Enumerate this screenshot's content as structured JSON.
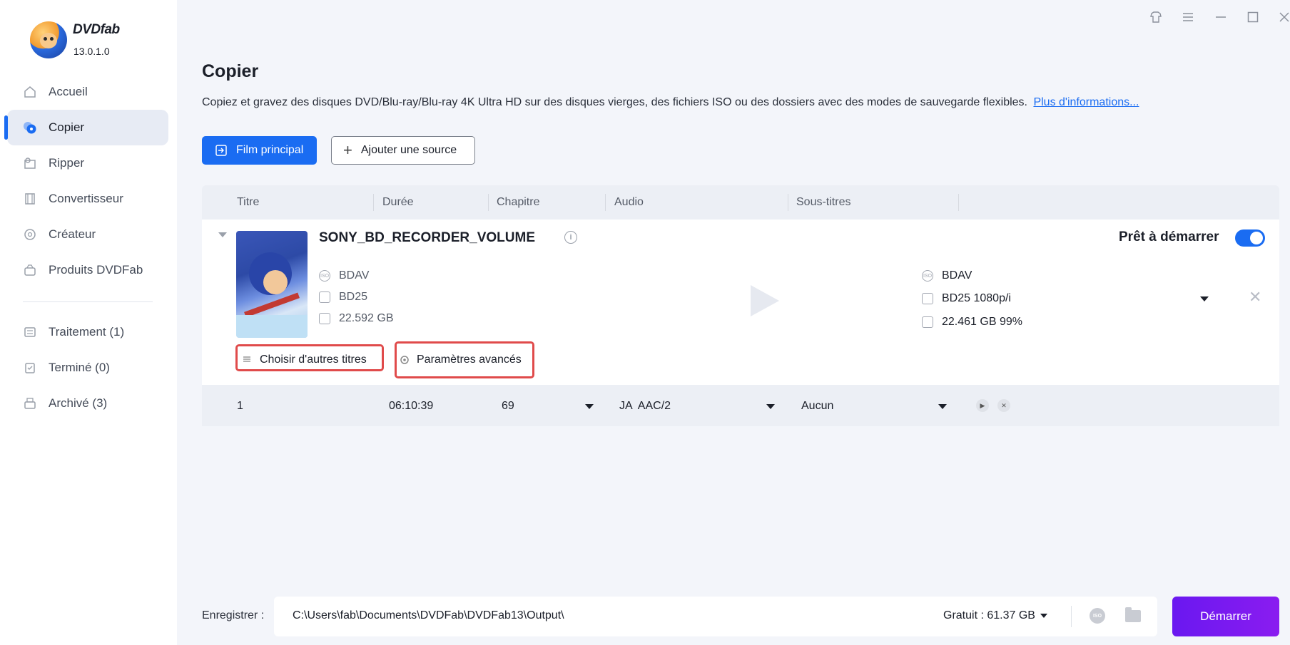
{
  "app": {
    "brand": "DVDfab",
    "version": "13.0.1.0"
  },
  "sidebar": {
    "items": [
      {
        "label": "Accueil",
        "icon": "home-icon"
      },
      {
        "label": "Copier",
        "icon": "copy-disc-icon",
        "active": true
      },
      {
        "label": "Ripper",
        "icon": "ripper-icon"
      },
      {
        "label": "Convertisseur",
        "icon": "film-icon"
      },
      {
        "label": "Créateur",
        "icon": "creator-icon"
      },
      {
        "label": "Produits DVDFab",
        "icon": "products-icon"
      }
    ],
    "queue": [
      {
        "label": "Traitement (1)",
        "icon": "processing-icon"
      },
      {
        "label": "Terminé (0)",
        "icon": "done-icon"
      },
      {
        "label": "Archivé (3)",
        "icon": "archive-icon"
      }
    ]
  },
  "header": {
    "title": "Copier",
    "description": "Copiez et gravez des disques DVD/Blu-ray/Blu-ray 4K Ultra HD sur des disques vierges, des fichiers ISO ou des dossiers avec des modes de sauvegarde flexibles.",
    "more_link": "Plus d'informations..."
  },
  "toolbar": {
    "main_movie": "Film principal",
    "add_source": "Ajouter une source"
  },
  "table": {
    "columns": [
      "Titre",
      "Durée",
      "Chapitre",
      "Audio",
      "Sous-titres"
    ]
  },
  "source": {
    "title": "SONY_BD_RECORDER_VOLUME",
    "format": "BDAV",
    "disc": "BD25",
    "size": "22.592 GB"
  },
  "output": {
    "format": "BDAV",
    "disc": "BD25 1080p/i",
    "size": "22.461 GB 99%"
  },
  "status": {
    "ready": "Prêt à démarrer",
    "toggle_on": true
  },
  "actions": {
    "choose_titles": "Choisir d'autres titres",
    "advanced": "Paramètres avancés"
  },
  "title_row": {
    "number": "1",
    "duration": "06:10:39",
    "chapter": "69",
    "audio": "JA  AAC/2",
    "subtitles": "Aucun"
  },
  "footer": {
    "save_label": "Enregistrer :",
    "path": "C:\\Users\\fab\\Documents\\DVDFab\\DVDFab13\\Output\\",
    "free": "Gratuit : 61.37 GB",
    "iso_icon": "ISO",
    "start": "Démarrer"
  },
  "colors": {
    "accent": "#1a6cf2",
    "start": "#7a1af0",
    "highlight": "#e04b4b"
  }
}
